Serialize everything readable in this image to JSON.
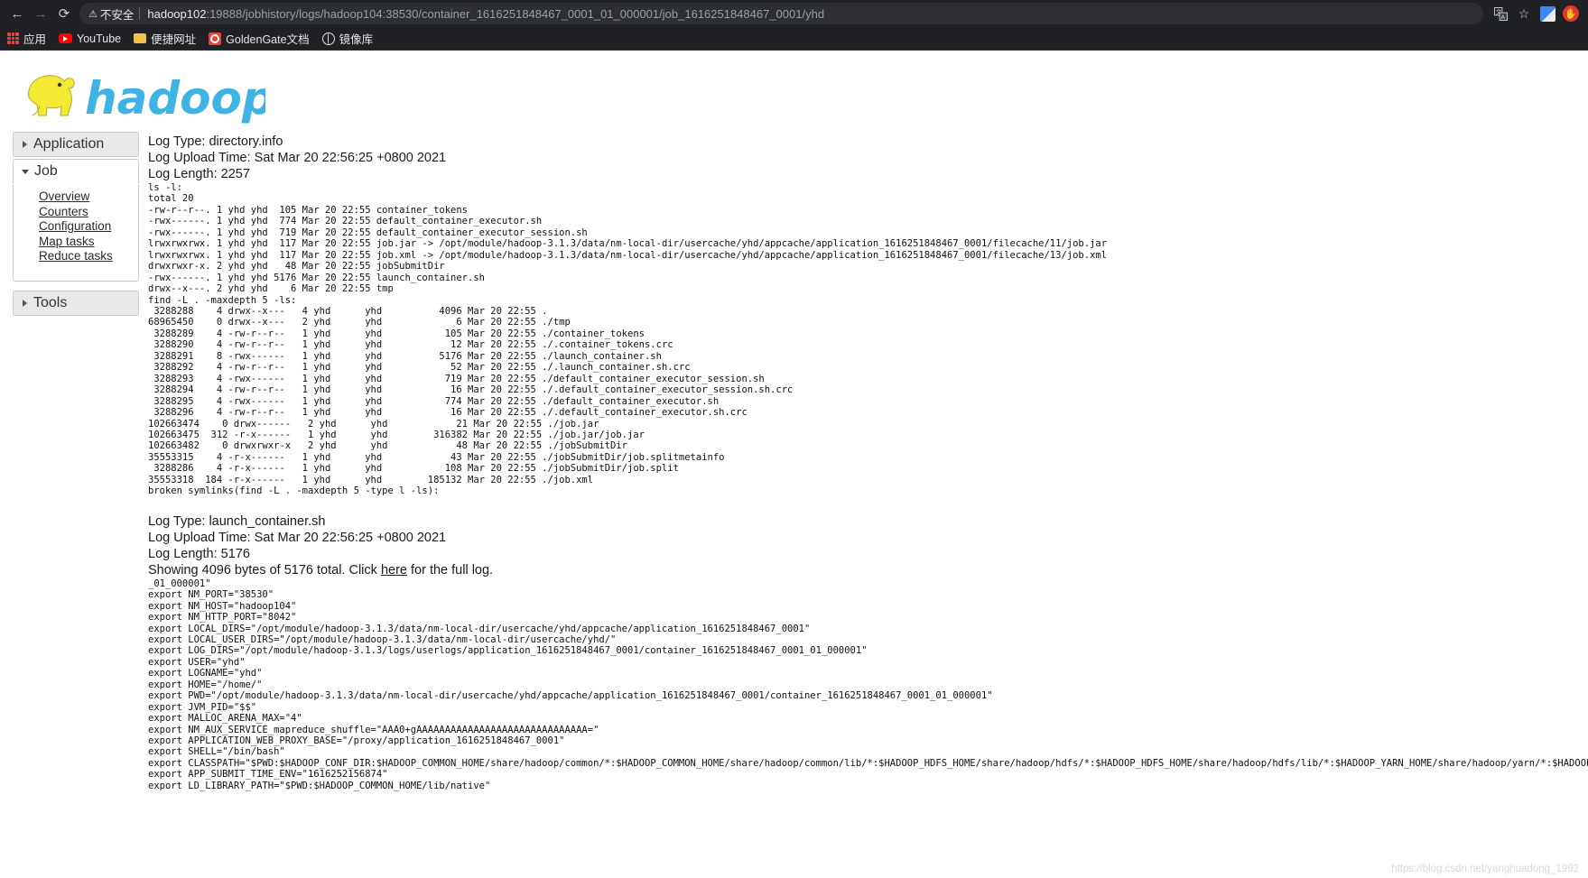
{
  "browser": {
    "back_icon": "back-arrow-icon",
    "forward_icon": "forward-arrow-icon",
    "reload_icon": "reload-icon",
    "security_warning_icon": "warning-triangle-icon",
    "security_warning_text": "不安全",
    "url_host": "hadoop102",
    "url_rest": ":19888/jobhistory/logs/hadoop104:38530/container_1616251848467_0001_01_000001/job_1616251848467_0001/yhd",
    "translate_icon": "translate-icon",
    "bookmark_star_icon": "star-icon",
    "extension_icon": "google-translate-extension-icon",
    "profile_icon": "profile-avatar-icon",
    "bookmarks": [
      {
        "label": "应用",
        "icon": "apps-grid-icon"
      },
      {
        "label": "YouTube",
        "icon": "youtube-icon"
      },
      {
        "label": "便捷网址",
        "icon": "folder-icon"
      },
      {
        "label": "GoldenGate文档",
        "icon": "goldengate-icon"
      },
      {
        "label": "镜像库",
        "icon": "globe-icon"
      }
    ]
  },
  "brand": {
    "name": "hadoop",
    "elephant_icon": "hadoop-elephant-logo",
    "text_color": "#40b4e5",
    "elephant_color": "#f2e63a"
  },
  "sidebar": {
    "sections": [
      {
        "label": "Application",
        "expanded": false,
        "links": []
      },
      {
        "label": "Job",
        "expanded": true,
        "links": [
          "Overview",
          "Counters",
          "Configuration",
          "Map tasks",
          "Reduce tasks"
        ]
      },
      {
        "label": "Tools",
        "expanded": false,
        "links": []
      }
    ]
  },
  "logs": [
    {
      "type_line": "Log Type: directory.info",
      "upload_line": "Log Upload Time: Sat Mar 20 22:56:25 +0800 2021",
      "length_line": "Log Length: 2257",
      "body": "ls -l:\ntotal 20\n-rw-r--r--. 1 yhd yhd  105 Mar 20 22:55 container_tokens\n-rwx------. 1 yhd yhd  774 Mar 20 22:55 default_container_executor.sh\n-rwx------. 1 yhd yhd  719 Mar 20 22:55 default_container_executor_session.sh\nlrwxrwxrwx. 1 yhd yhd  117 Mar 20 22:55 job.jar -> /opt/module/hadoop-3.1.3/data/nm-local-dir/usercache/yhd/appcache/application_1616251848467_0001/filecache/11/job.jar\nlrwxrwxrwx. 1 yhd yhd  117 Mar 20 22:55 job.xml -> /opt/module/hadoop-3.1.3/data/nm-local-dir/usercache/yhd/appcache/application_1616251848467_0001/filecache/13/job.xml\ndrwxrwxr-x. 2 yhd yhd   48 Mar 20 22:55 jobSubmitDir\n-rwx------. 1 yhd yhd 5176 Mar 20 22:55 launch_container.sh\ndrwx--x---. 2 yhd yhd    6 Mar 20 22:55 tmp\nfind -L . -maxdepth 5 -ls:\n 3288288    4 drwx--x---   4 yhd      yhd          4096 Mar 20 22:55 .\n68965450    0 drwx--x---   2 yhd      yhd             6 Mar 20 22:55 ./tmp\n 3288289    4 -rw-r--r--   1 yhd      yhd           105 Mar 20 22:55 ./container_tokens\n 3288290    4 -rw-r--r--   1 yhd      yhd            12 Mar 20 22:55 ./.container_tokens.crc\n 3288291    8 -rwx------   1 yhd      yhd          5176 Mar 20 22:55 ./launch_container.sh\n 3288292    4 -rw-r--r--   1 yhd      yhd            52 Mar 20 22:55 ./.launch_container.sh.crc\n 3288293    4 -rwx------   1 yhd      yhd           719 Mar 20 22:55 ./default_container_executor_session.sh\n 3288294    4 -rw-r--r--   1 yhd      yhd            16 Mar 20 22:55 ./.default_container_executor_session.sh.crc\n 3288295    4 -rwx------   1 yhd      yhd           774 Mar 20 22:55 ./default_container_executor.sh\n 3288296    4 -rw-r--r--   1 yhd      yhd            16 Mar 20 22:55 ./.default_container_executor.sh.crc\n102663474    0 drwx------   2 yhd      yhd            21 Mar 20 22:55 ./job.jar\n102663475  312 -r-x------   1 yhd      yhd        316382 Mar 20 22:55 ./job.jar/job.jar\n102663482    0 drwxrwxr-x   2 yhd      yhd            48 Mar 20 22:55 ./jobSubmitDir\n35553315    4 -r-x------   1 yhd      yhd            43 Mar 20 22:55 ./jobSubmitDir/job.splitmetainfo\n 3288286    4 -r-x------   1 yhd      yhd           108 Mar 20 22:55 ./jobSubmitDir/job.split\n35553318  184 -r-x------   1 yhd      yhd        185132 Mar 20 22:55 ./job.xml\nbroken symlinks(find -L . -maxdepth 5 -type l -ls):"
    },
    {
      "type_line": "Log Type: launch_container.sh",
      "upload_line": "Log Upload Time: Sat Mar 20 22:56:25 +0800 2021",
      "length_line": "Log Length: 5176",
      "showing_prefix": "Showing 4096 bytes of 5176 total. Click ",
      "showing_link": "here",
      "showing_suffix": " for the full log.",
      "body": "_01_000001\"\nexport NM_PORT=\"38530\"\nexport NM_HOST=\"hadoop104\"\nexport NM_HTTP_PORT=\"8042\"\nexport LOCAL_DIRS=\"/opt/module/hadoop-3.1.3/data/nm-local-dir/usercache/yhd/appcache/application_1616251848467_0001\"\nexport LOCAL_USER_DIRS=\"/opt/module/hadoop-3.1.3/data/nm-local-dir/usercache/yhd/\"\nexport LOG_DIRS=\"/opt/module/hadoop-3.1.3/logs/userlogs/application_1616251848467_0001/container_1616251848467_0001_01_000001\"\nexport USER=\"yhd\"\nexport LOGNAME=\"yhd\"\nexport HOME=\"/home/\"\nexport PWD=\"/opt/module/hadoop-3.1.3/data/nm-local-dir/usercache/yhd/appcache/application_1616251848467_0001/container_1616251848467_0001_01_000001\"\nexport JVM_PID=\"$$\"\nexport MALLOC_ARENA_MAX=\"4\"\nexport NM_AUX_SERVICE_mapreduce_shuffle=\"AAA0+gAAAAAAAAAAAAAAAAAAAAAAAAAAAAAA=\"\nexport APPLICATION_WEB_PROXY_BASE=\"/proxy/application_1616251848467_0001\"\nexport SHELL=\"/bin/bash\"\nexport CLASSPATH=\"$PWD:$HADOOP_CONF_DIR:$HADOOP_COMMON_HOME/share/hadoop/common/*:$HADOOP_COMMON_HOME/share/hadoop/common/lib/*:$HADOOP_HDFS_HOME/share/hadoop/hdfs/*:$HADOOP_HDFS_HOME/share/hadoop/hdfs/lib/*:$HADOOP_YARN_HOME/share/hadoop/yarn/*:$HADOOP_YARN_HOME\nexport APP_SUBMIT_TIME_ENV=\"1616252156874\"\nexport LD_LIBRARY_PATH=\"$PWD:$HADOOP_COMMON_HOME/lib/native\""
    }
  ],
  "watermark": "https://blog.csdn.net/yanghuadong_1992"
}
